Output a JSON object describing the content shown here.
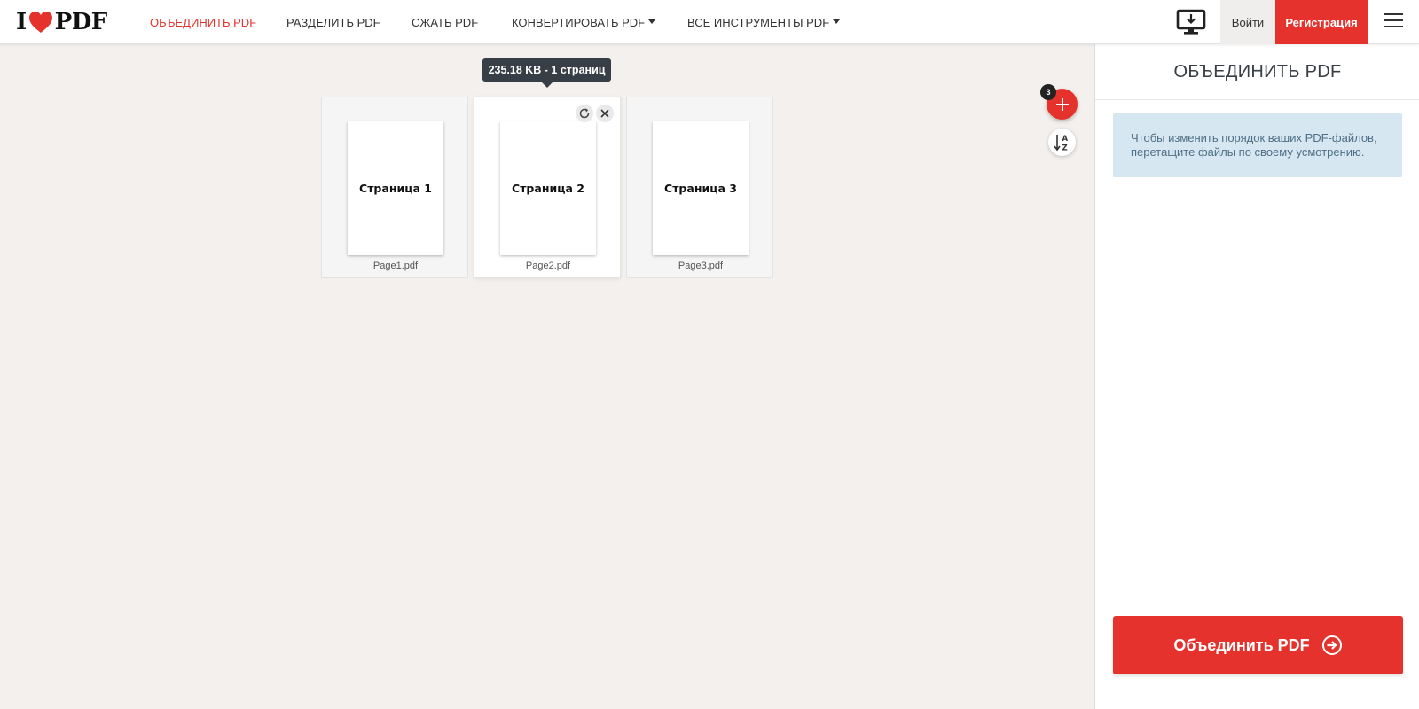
{
  "header": {
    "logo": {
      "left": "I",
      "right": "PDF",
      "icon": "heart-icon"
    },
    "nav": [
      {
        "label": "ОБЪЕДИНИТЬ PDF",
        "active": true
      },
      {
        "label": "РАЗДЕЛИТЬ PDF",
        "active": false
      },
      {
        "label": "СЖАТЬ PDF",
        "active": false
      },
      {
        "label": "КОНВЕРТИРОВАТЬ PDF",
        "active": false,
        "dropdown": true
      },
      {
        "label": "ВСЕ ИНСТРУМЕНТЫ PDF",
        "active": false,
        "dropdown": true
      }
    ],
    "desktop_icon": "desktop-download-icon",
    "login_label": "Войти",
    "register_label": "Регистрация",
    "menu_icon": "hamburger-icon"
  },
  "workspace": {
    "tooltip": "235.18 KB - 1 страниц",
    "files": [
      {
        "page_label": "Страница 1",
        "name": "Page1.pdf"
      },
      {
        "page_label": "Страница 2",
        "name": "Page2.pdf"
      },
      {
        "page_label": "Страница 3",
        "name": "Page3.pdf"
      }
    ],
    "file_count": "3",
    "add_icon": "plus-icon",
    "sort_icon": "sort-az-icon",
    "rotate_icon": "rotate-icon",
    "remove_icon": "close-icon"
  },
  "sidebar": {
    "title": "ОБЪЕДИНИТЬ PDF",
    "info_line1": "Чтобы изменить порядок ваших PDF-файлов,",
    "info_line2": "перетащите файлы по своему усмотрению.",
    "merge_label": "Объединить PDF",
    "merge_icon": "arrow-right-circle-icon"
  },
  "colors": {
    "brand": "#e5322d",
    "background": "#f3f0ed",
    "info_box": "#d6e7f2",
    "tooltip": "#383e45"
  }
}
